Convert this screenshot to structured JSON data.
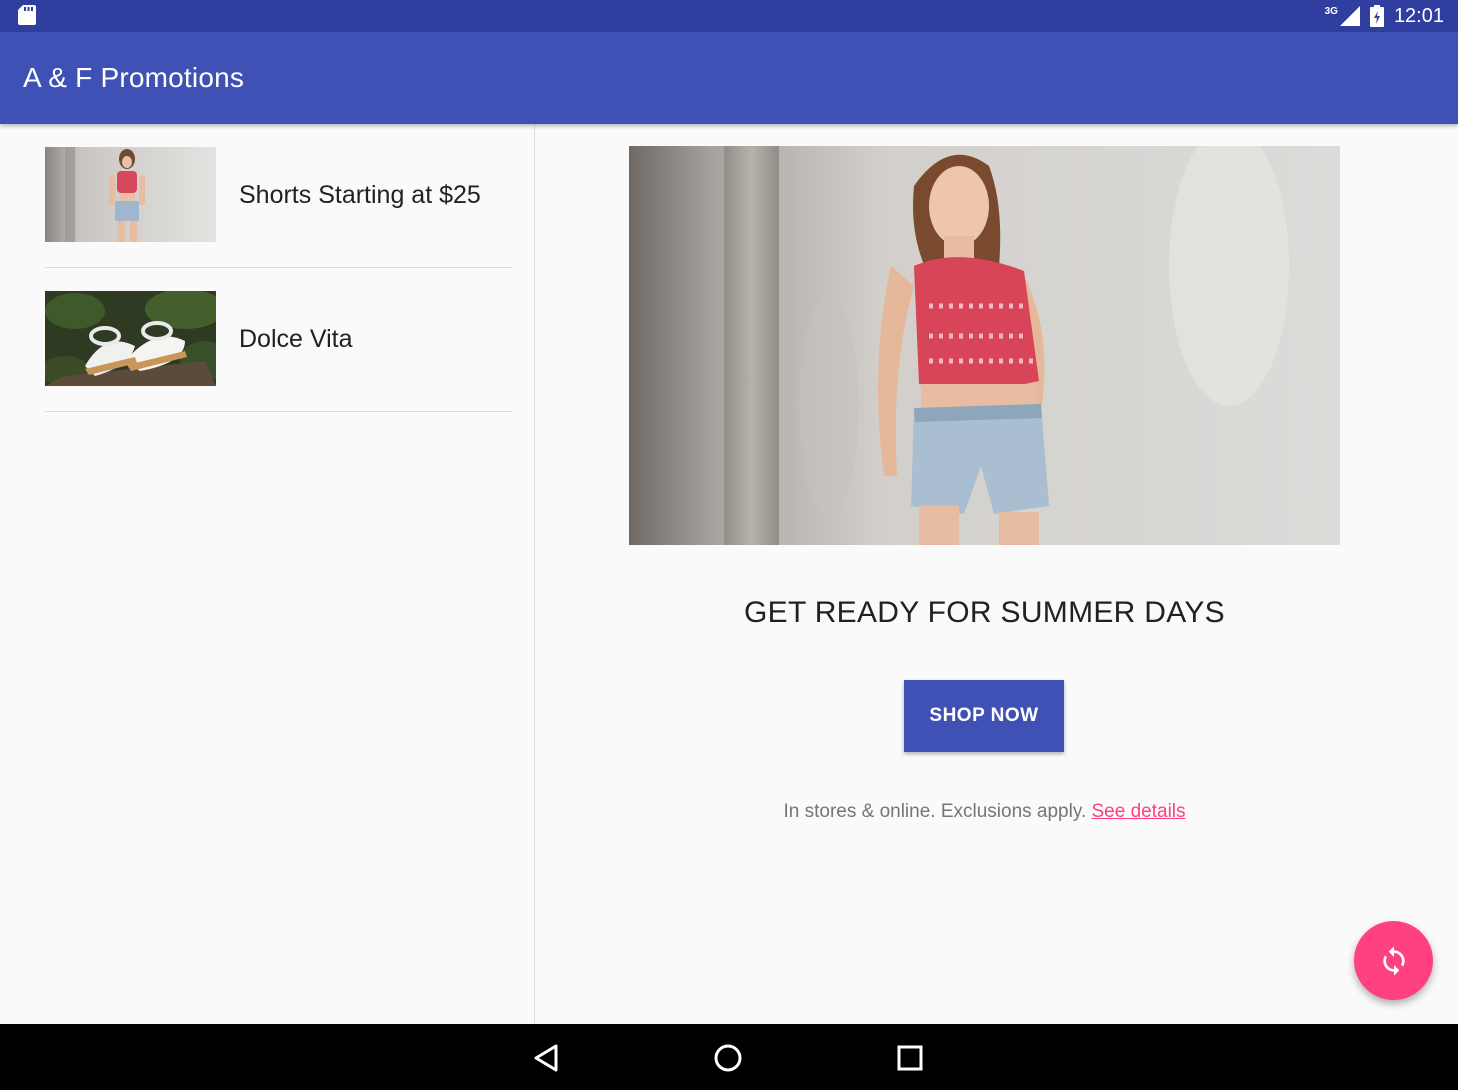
{
  "status_bar": {
    "network": "3G",
    "time": "12:01",
    "icons": [
      "sd-card-icon",
      "signal-icon",
      "battery-icon"
    ]
  },
  "app_bar": {
    "title": "A & F Promotions"
  },
  "promotions": [
    {
      "title": "Shorts Starting at $25",
      "thumb_icon": "model-photo"
    },
    {
      "title": "Dolce Vita",
      "thumb_icon": "sandals-photo"
    }
  ],
  "detail": {
    "headline": "GET READY FOR SUMMER DAYS",
    "button_label": "SHOP NOW",
    "fine_print": "In stores & online. Exclusions apply.",
    "link_label": "See details"
  },
  "fab": {
    "icon": "sync-icon"
  },
  "nav": {
    "icons": [
      "back-icon",
      "home-icon",
      "recents-icon"
    ]
  },
  "colors": {
    "primary": "#3f51b5",
    "primary_dark": "#303f9f",
    "accent": "#ff4081"
  }
}
